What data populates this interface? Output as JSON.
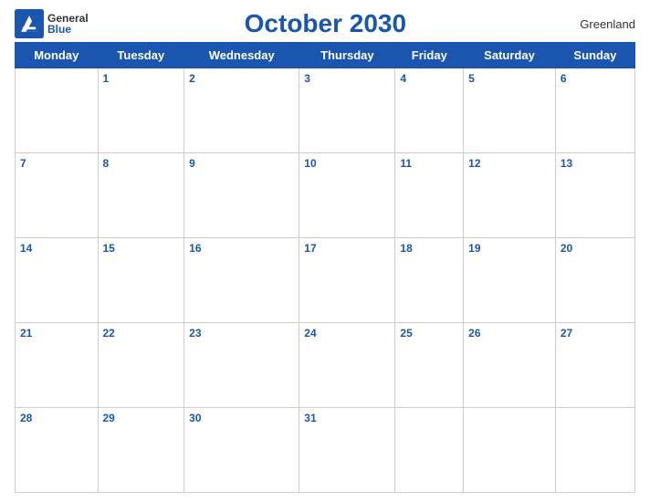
{
  "header": {
    "title": "October 2030",
    "region": "Greenland",
    "logo_general": "General",
    "logo_blue": "Blue"
  },
  "weekdays": [
    "Monday",
    "Tuesday",
    "Wednesday",
    "Thursday",
    "Friday",
    "Saturday",
    "Sunday"
  ],
  "weeks": [
    [
      null,
      1,
      2,
      3,
      4,
      5,
      6
    ],
    [
      7,
      8,
      9,
      10,
      11,
      12,
      13
    ],
    [
      14,
      15,
      16,
      17,
      18,
      19,
      20
    ],
    [
      21,
      22,
      23,
      24,
      25,
      26,
      27
    ],
    [
      28,
      29,
      30,
      31,
      null,
      null,
      null
    ]
  ]
}
